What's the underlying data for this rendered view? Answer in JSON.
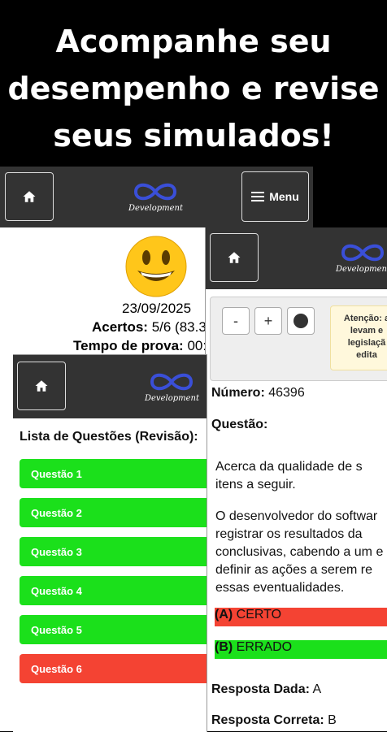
{
  "headline": [
    "Acompanhe seu",
    "desempenho e revise",
    "seus simulados!"
  ],
  "logo_text": "Development",
  "menu_label": "Menu",
  "result": {
    "date": "23/09/2025",
    "acertos_label": "Acertos:",
    "acertos_value": "5/6 (83.3",
    "tempo_label": "Tempo de prova:",
    "tempo_value": "00:"
  },
  "question": {
    "minus": "-",
    "plus": "+",
    "notice_lines": [
      "Atenção: a",
      "levam e",
      "legislaçã",
      "edita"
    ],
    "numero_label": "Número:",
    "numero_value": "46396",
    "questao_label": "Questão:",
    "para1": [
      "Acerca da qualidade de s",
      "itens a seguir."
    ],
    "para2": [
      "O desenvolvedor do softwar",
      "registrar os resultados da",
      "conclusivas, cabendo a um e",
      "definir as ações a serem re",
      "essas eventualidades."
    ],
    "option_a_letter": "(A)",
    "option_a_text": "CERTO",
    "option_b_letter": "(B)",
    "option_b_text": "ERRADO",
    "resposta_dada_label": "Resposta Dada:",
    "resposta_dada_value": "A",
    "resposta_correta_label": "Resposta Correta:",
    "resposta_correta_value": "B"
  },
  "review": {
    "title": "Lista de Questões (Revisão):",
    "items": [
      "Questão 1",
      "Questão 2",
      "Questão 3",
      "Questão 4",
      "Questão 5",
      "Questão 6"
    ],
    "status": [
      "correct",
      "correct",
      "correct",
      "correct",
      "correct",
      "wrong"
    ]
  },
  "colors": {
    "correct": "#1be01b",
    "wrong": "#f44333",
    "navbar": "#333333",
    "notice_bg": "#fff8dc"
  }
}
